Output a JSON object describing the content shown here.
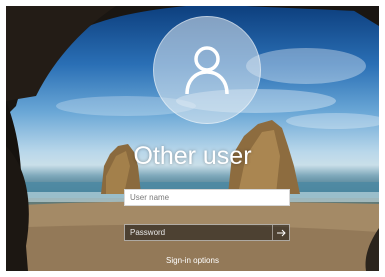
{
  "user": {
    "name": "Other user",
    "avatar_icon": "user-silhouette-icon"
  },
  "username_field": {
    "placeholder": "User name",
    "value": ""
  },
  "password_field": {
    "placeholder": "Password",
    "value": ""
  },
  "submit_button": {
    "icon": "arrow-right-icon"
  },
  "sign_in_options": {
    "label": "Sign-in options"
  },
  "colors": {
    "sky_top": "#0d3f7e",
    "sand": "#a78c66",
    "cave": "#1a1612"
  }
}
